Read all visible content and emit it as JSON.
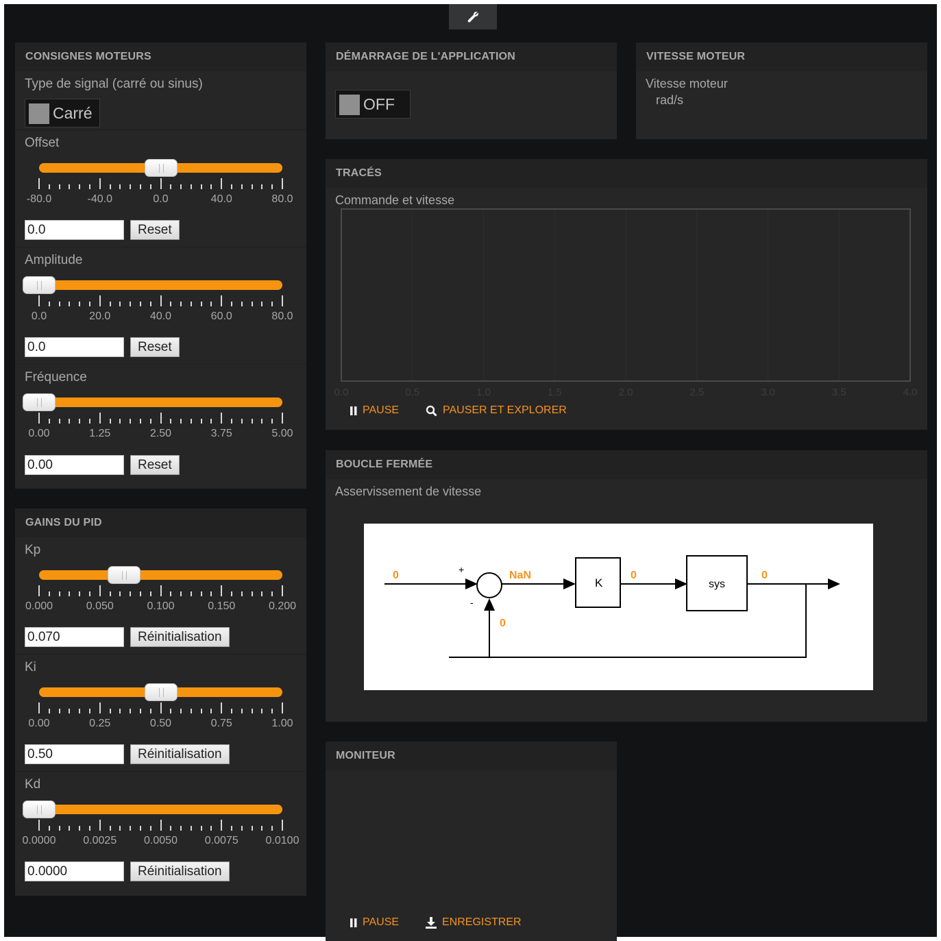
{
  "colors": {
    "accent": "#f7941d",
    "background": "#121314",
    "panel": "#262627"
  },
  "toolbar": {
    "settings_icon": "wrench-icon"
  },
  "consignes": {
    "title": "CONSIGNES MOTEURS",
    "signal": {
      "label": "Type de signal (carré ou sinus)",
      "toggle_text": "Carré"
    },
    "offset": {
      "label": "Offset",
      "ticks": [
        "-80.0",
        "-40.0",
        "0.0",
        "40.0",
        "80.0"
      ],
      "value": "0.0",
      "reset": "Reset",
      "min": -80,
      "max": 80,
      "current": 0
    },
    "amplitude": {
      "label": "Amplitude",
      "ticks": [
        "0.0",
        "20.0",
        "40.0",
        "60.0",
        "80.0"
      ],
      "value": "0.0",
      "reset": "Reset",
      "min": 0,
      "max": 80,
      "current": 0
    },
    "frequence": {
      "label": "Fréquence",
      "ticks": [
        "0.00",
        "1.25",
        "2.50",
        "3.75",
        "5.00"
      ],
      "value": "0.00",
      "reset": "Reset",
      "min": 0,
      "max": 5,
      "current": 0
    }
  },
  "pid": {
    "title": "GAINS DU PID",
    "kp": {
      "label": "Kp",
      "ticks": [
        "0.000",
        "0.050",
        "0.100",
        "0.150",
        "0.200"
      ],
      "value": "0.070",
      "reset": "Réinitialisation",
      "min": 0,
      "max": 0.2,
      "current": 0.07
    },
    "ki": {
      "label": "Ki",
      "ticks": [
        "0.00",
        "0.25",
        "0.50",
        "0.75",
        "1.00"
      ],
      "value": "0.50",
      "reset": "Réinitialisation",
      "min": 0,
      "max": 1,
      "current": 0.5
    },
    "kd": {
      "label": "Kd",
      "ticks": [
        "0.0000",
        "0.0025",
        "0.0050",
        "0.0075",
        "0.0100"
      ],
      "value": "0.0000",
      "reset": "Réinitialisation",
      "min": 0,
      "max": 0.01,
      "current": 0
    }
  },
  "demarrage": {
    "title": "DÉMARRAGE DE L'APPLICATION",
    "toggle_text": "OFF"
  },
  "vitesse": {
    "title": "VITESSE MOTEUR",
    "label": "Vitesse moteur",
    "unit": "rad/s"
  },
  "traces": {
    "title": "TRACÉS",
    "chart_title": "Commande et vitesse",
    "x_ticks": [
      "0.0",
      "0.5",
      "1.0",
      "1.5",
      "2.0",
      "2.5",
      "3.0",
      "3.5",
      "4.0"
    ],
    "pause": "PAUSE",
    "explore": "PAUSER ET EXPLORER"
  },
  "chart_data": {
    "type": "line",
    "title": "Commande et vitesse",
    "xlim": [
      0,
      4
    ],
    "x_ticks": [
      0,
      0.5,
      1.0,
      1.5,
      2.0,
      2.5,
      3.0,
      3.5,
      4.0
    ],
    "series": [],
    "grid": true
  },
  "boucle": {
    "title": "BOUCLE FERMÉE",
    "subtitle": "Asservissement de vitesse",
    "input_value": "0",
    "plus": "+",
    "minus": "-",
    "error_value": "NaN",
    "block_k": "K",
    "k_output": "0",
    "block_sys": "sys",
    "sys_output": "0",
    "feedback_value": "0"
  },
  "moniteur": {
    "title": "MONITEUR",
    "pause": "PAUSE",
    "save": "ENREGISTRER"
  }
}
